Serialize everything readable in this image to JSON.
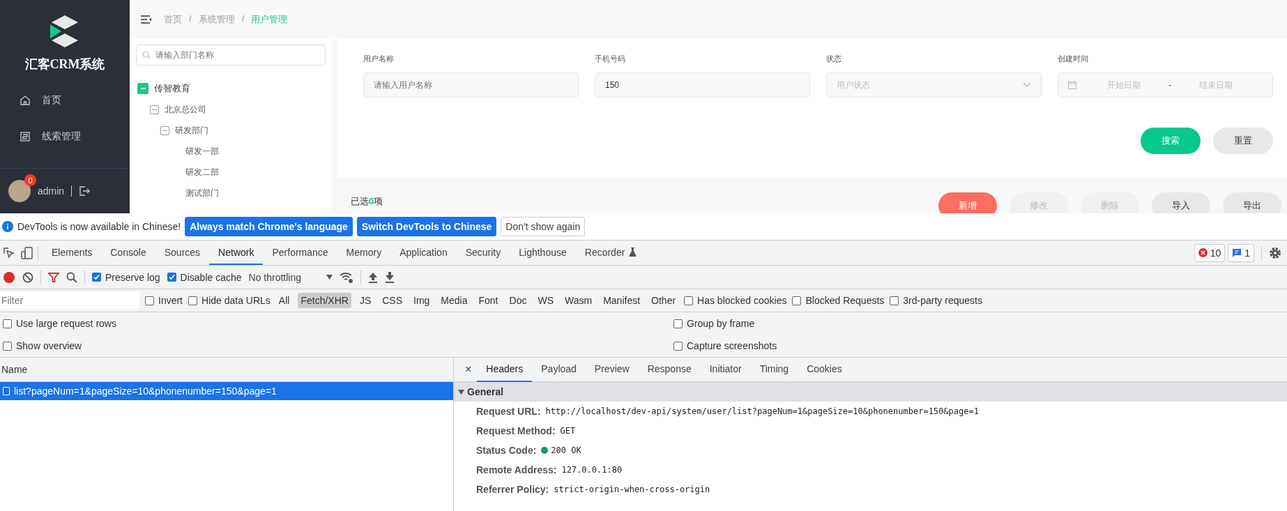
{
  "app": {
    "logo_text": "汇客CRM系统",
    "nav": [
      {
        "label": "首页",
        "kind": "home"
      },
      {
        "label": "线索管理",
        "kind": "clue"
      }
    ],
    "user": {
      "name": "admin",
      "badge": "0"
    },
    "breadcrumb": [
      {
        "label": "首页",
        "kind": "link"
      },
      {
        "label": "/",
        "kind": "sep"
      },
      {
        "label": "系统管理",
        "kind": "link"
      },
      {
        "label": "/",
        "kind": "sep"
      },
      {
        "label": "用户管理",
        "kind": "current"
      }
    ],
    "dept_search": {
      "placeholder": "请输入部门名称"
    },
    "dept_tree": [
      {
        "label": "传智教育",
        "selected": true,
        "expanded": true,
        "children": [
          {
            "label": "北京总公司",
            "selected": false,
            "expanded": true,
            "children": [
              {
                "label": "研发部门",
                "selected": false,
                "expanded": true,
                "children": [
                  {
                    "label": "研发一部",
                    "selected": false
                  },
                  {
                    "label": "研发二部",
                    "selected": false
                  },
                  {
                    "label": "测试部门",
                    "selected": false
                  }
                ]
              }
            ]
          }
        ]
      }
    ],
    "filters": [
      {
        "label": "用户名称",
        "kind": "input",
        "placeholder": "请输入用户名称"
      },
      {
        "label": "手机号码",
        "kind": "input",
        "value": "150"
      },
      {
        "label": "状态",
        "kind": "select",
        "placeholder": "用户状态"
      },
      {
        "label": "创建时间",
        "kind": "daterange",
        "start_placeholder": "开始日期",
        "separator": "-",
        "end_placeholder": "结束日期"
      }
    ],
    "search_buttons": [
      {
        "label": "搜索",
        "kind": "primary"
      },
      {
        "label": "重置",
        "kind": "default"
      }
    ],
    "selection": "已选**0**项",
    "actions": [
      {
        "label": "新增",
        "kind": "danger",
        "disabled": false
      },
      {
        "label": "修改",
        "kind": "default",
        "disabled": true
      },
      {
        "label": "删除",
        "kind": "default",
        "disabled": true
      },
      {
        "label": "导入",
        "kind": "default",
        "disabled": false
      },
      {
        "label": "导出",
        "kind": "default",
        "disabled": false
      }
    ]
  },
  "devtools": {
    "infobar": {
      "message": "DevTools is now available in Chinese!",
      "buttons": [
        {
          "label": "Always match Chrome's language",
          "kind": "primary"
        },
        {
          "label": "Switch DevTools to Chinese",
          "kind": "primary"
        },
        {
          "label": "Don't show again",
          "kind": "plain"
        }
      ]
    },
    "tabs": [
      {
        "label": "Elements",
        "selected": false,
        "experimental": false
      },
      {
        "label": "Console",
        "selected": false,
        "experimental": false
      },
      {
        "label": "Sources",
        "selected": false,
        "experimental": false
      },
      {
        "label": "Network",
        "selected": true,
        "experimental": false
      },
      {
        "label": "Performance",
        "selected": false,
        "experimental": false
      },
      {
        "label": "Memory",
        "selected": false,
        "experimental": false
      },
      {
        "label": "Application",
        "selected": false,
        "experimental": false
      },
      {
        "label": "Security",
        "selected": false,
        "experimental": false
      },
      {
        "label": "Lighthouse",
        "selected": false,
        "experimental": false
      },
      {
        "label": "Recorder",
        "selected": false,
        "experimental": true
      }
    ],
    "error_count": "10",
    "message_count": "1",
    "toolbar": {
      "recording": true,
      "checkboxes": [
        {
          "label": "Preserve log",
          "checked": true
        },
        {
          "label": "Disable cache",
          "checked": true
        }
      ],
      "throttling": "No throttling"
    },
    "filter": {
      "placeholder": "Filter",
      "checkboxes": [
        {
          "label": "Invert",
          "checked": false
        },
        {
          "label": "Hide data URLs",
          "checked": false
        }
      ],
      "types": [
        {
          "label": "All",
          "selected": false
        },
        {
          "label": "Fetch/XHR",
          "selected": true
        },
        {
          "label": "JS",
          "selected": false
        },
        {
          "label": "CSS",
          "selected": false
        },
        {
          "label": "Img",
          "selected": false
        },
        {
          "label": "Media",
          "selected": false
        },
        {
          "label": "Font",
          "selected": false
        },
        {
          "label": "Doc",
          "selected": false
        },
        {
          "label": "WS",
          "selected": false
        },
        {
          "label": "Wasm",
          "selected": false
        },
        {
          "label": "Manifest",
          "selected": false
        },
        {
          "label": "Other",
          "selected": false
        }
      ],
      "extra_checkboxes": [
        {
          "label": "Has blocked cookies",
          "checked": false
        },
        {
          "label": "Blocked Requests",
          "checked": false
        },
        {
          "label": "3rd-party requests",
          "checked": false
        }
      ]
    },
    "settings_left": [
      {
        "label": "Use large request rows",
        "checked": false
      },
      {
        "label": "Show overview",
        "checked": false
      }
    ],
    "settings_right": [
      {
        "label": "Group by frame",
        "checked": false
      },
      {
        "label": "Capture screenshots",
        "checked": false
      }
    ],
    "requests": {
      "column": "Name",
      "rows": [
        {
          "name": "list?pageNum=1&pageSize=10&phonenumber=150&page=1",
          "selected": true
        }
      ]
    },
    "detail": {
      "close": "×",
      "tabs": [
        {
          "label": "Headers",
          "selected": true
        },
        {
          "label": "Payload",
          "selected": false
        },
        {
          "label": "Preview",
          "selected": false
        },
        {
          "label": "Response",
          "selected": false
        },
        {
          "label": "Initiator",
          "selected": false
        },
        {
          "label": "Timing",
          "selected": false
        },
        {
          "label": "Cookies",
          "selected": false
        }
      ],
      "section": {
        "title": "General",
        "expanded": true,
        "rows": [
          {
            "key": "Request URL:",
            "value": "http://localhost/dev-api/system/user/list?pageNum=1&pageSize=10&phonenumber=150&page=1",
            "kind": "plain"
          },
          {
            "key": "Request Method:",
            "value": "GET",
            "kind": "plain"
          },
          {
            "key": "Status Code:",
            "value": "200 OK",
            "kind": "status"
          },
          {
            "key": "Remote Address:",
            "value": "127.0.0.1:80",
            "kind": "plain"
          },
          {
            "key": "Referrer Policy:",
            "value": "strict-origin-when-cross-origin",
            "kind": "plain"
          }
        ]
      }
    }
  }
}
